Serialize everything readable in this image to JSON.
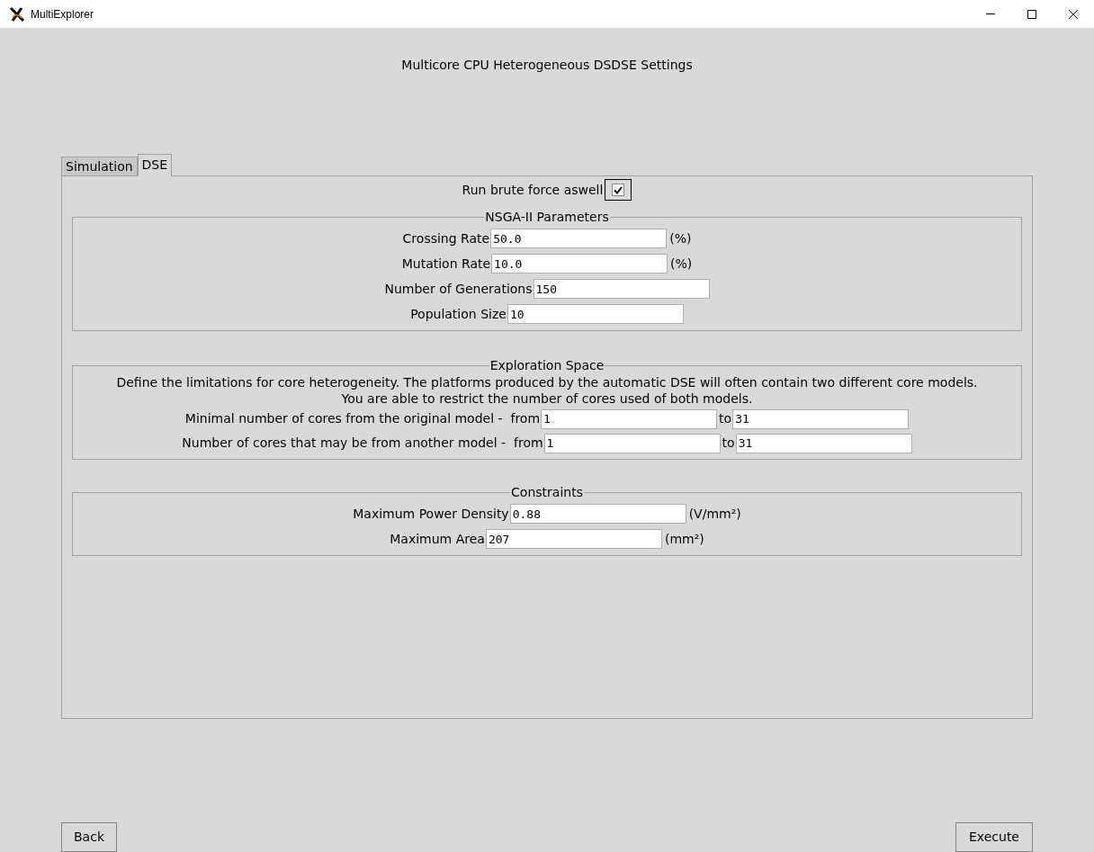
{
  "window": {
    "title": "MultiExplorer"
  },
  "heading": "Multicore CPU Heterogeneous DSDSE Settings",
  "tabs": [
    {
      "label": "Simulation",
      "selected": false
    },
    {
      "label": "DSE",
      "selected": true
    }
  ],
  "brute_force": {
    "label": "Run brute force aswell",
    "checked": true
  },
  "sections": [
    {
      "kind": "params",
      "title": "NSGA-II Parameters",
      "rows": [
        {
          "label": "Crossing Rate",
          "value": "50.0",
          "unit": "(%)"
        },
        {
          "label": "Mutation Rate",
          "value": "10.0",
          "unit": "(%)"
        },
        {
          "label": "Number of Generations",
          "value": "150"
        },
        {
          "label": "Population Size",
          "value": "10"
        }
      ]
    },
    {
      "kind": "range",
      "title": "Exploration Space",
      "description": [
        "Define the limitations for core heterogeneity. The platforms produced by the automatic DSE will often contain two different core models.",
        "You are able to restrict the number of cores used of both models."
      ],
      "rows": [
        {
          "label": "Minimal number of cores from the original model -  from",
          "value": "1",
          "to_label": "to",
          "to_value": "31"
        },
        {
          "label": "Number of cores that may be from another model -  from",
          "value": "1",
          "to_label": "to",
          "to_value": "31"
        }
      ]
    },
    {
      "kind": "params",
      "title": "Constraints",
      "rows": [
        {
          "label": "Maximum Power Density",
          "value": "0.88",
          "unit": "(V/mm²)"
        },
        {
          "label": "Maximum Area",
          "value": "207",
          "unit": "(mm²)"
        }
      ]
    }
  ],
  "buttons": {
    "back": "Back",
    "execute": "Execute"
  }
}
